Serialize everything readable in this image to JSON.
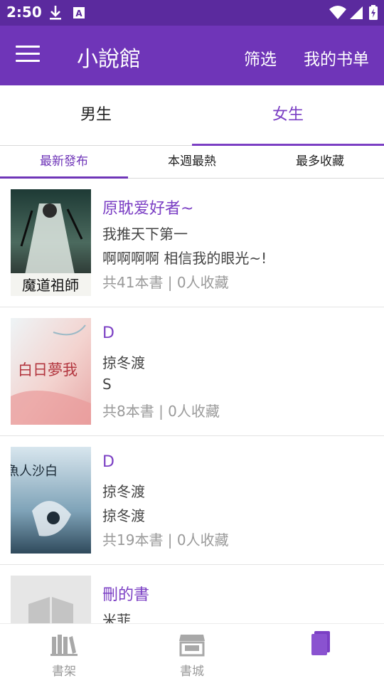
{
  "status_bar": {
    "time": "2:50",
    "icons": [
      "download-icon",
      "a-notification-icon",
      "wifi-icon",
      "signal-icon",
      "battery-icon"
    ]
  },
  "app_bar": {
    "menu_icon": "menu-icon",
    "title": "小說館",
    "filter_label": "筛选",
    "my_booklist_label": "我的书单"
  },
  "gender_tabs": [
    {
      "label": "男生",
      "active": false
    },
    {
      "label": "女生",
      "active": true
    }
  ],
  "sort_tabs": [
    {
      "label": "最新發布",
      "active": true
    },
    {
      "label": "本週最熱",
      "active": false
    },
    {
      "label": "最多收藏",
      "active": false
    }
  ],
  "booklists": [
    {
      "title": "原耽爱好者~",
      "author": "我推天下第一",
      "description": "啊啊啊啊 相信我的眼光~!",
      "meta": "共41本書 |  0人收藏",
      "cover_text": "魔道祖師"
    },
    {
      "title": "D",
      "author": "掠冬渡",
      "description": "S",
      "meta": "共8本書 |  0人收藏",
      "cover_text": "白日夢我"
    },
    {
      "title": "D",
      "author": "掠冬渡",
      "description": "掠冬渡",
      "meta": "共19本書 |  0人收藏",
      "cover_text": "魚人沙白"
    },
    {
      "title": "刪的書",
      "author": "米菲",
      "description": "",
      "meta": "",
      "cover_text": ""
    }
  ],
  "bottom_nav": [
    {
      "label": "書架",
      "icon": "bookshelf-icon"
    },
    {
      "label": "書城",
      "icon": "store-icon"
    },
    {
      "label": "",
      "icon": "booklist-icon"
    }
  ],
  "colors": {
    "status_bar": "#5b2a9e",
    "app_bar": "#6f35b8",
    "accent": "#7b3fc4"
  }
}
